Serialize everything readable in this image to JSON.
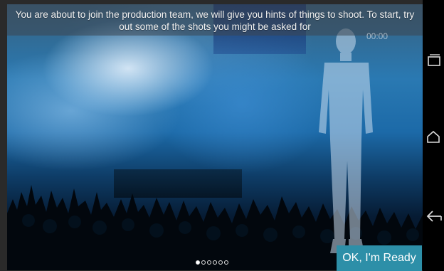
{
  "hint": {
    "text": "You are about to join the production team, we will give you hints of things to shoot. To start, try out some of the shots you might be asked for"
  },
  "timer": {
    "text": "00:00"
  },
  "pager": {
    "count": 6,
    "active_index": 0
  },
  "ok_button": {
    "label": "OK, I'm Ready"
  },
  "nav": {
    "icons": [
      "recent-apps-icon",
      "home-icon",
      "back-icon"
    ]
  },
  "colors": {
    "accent": "#2d8fa8",
    "nav_background": "#000000",
    "hint_background": "#3c4650"
  }
}
